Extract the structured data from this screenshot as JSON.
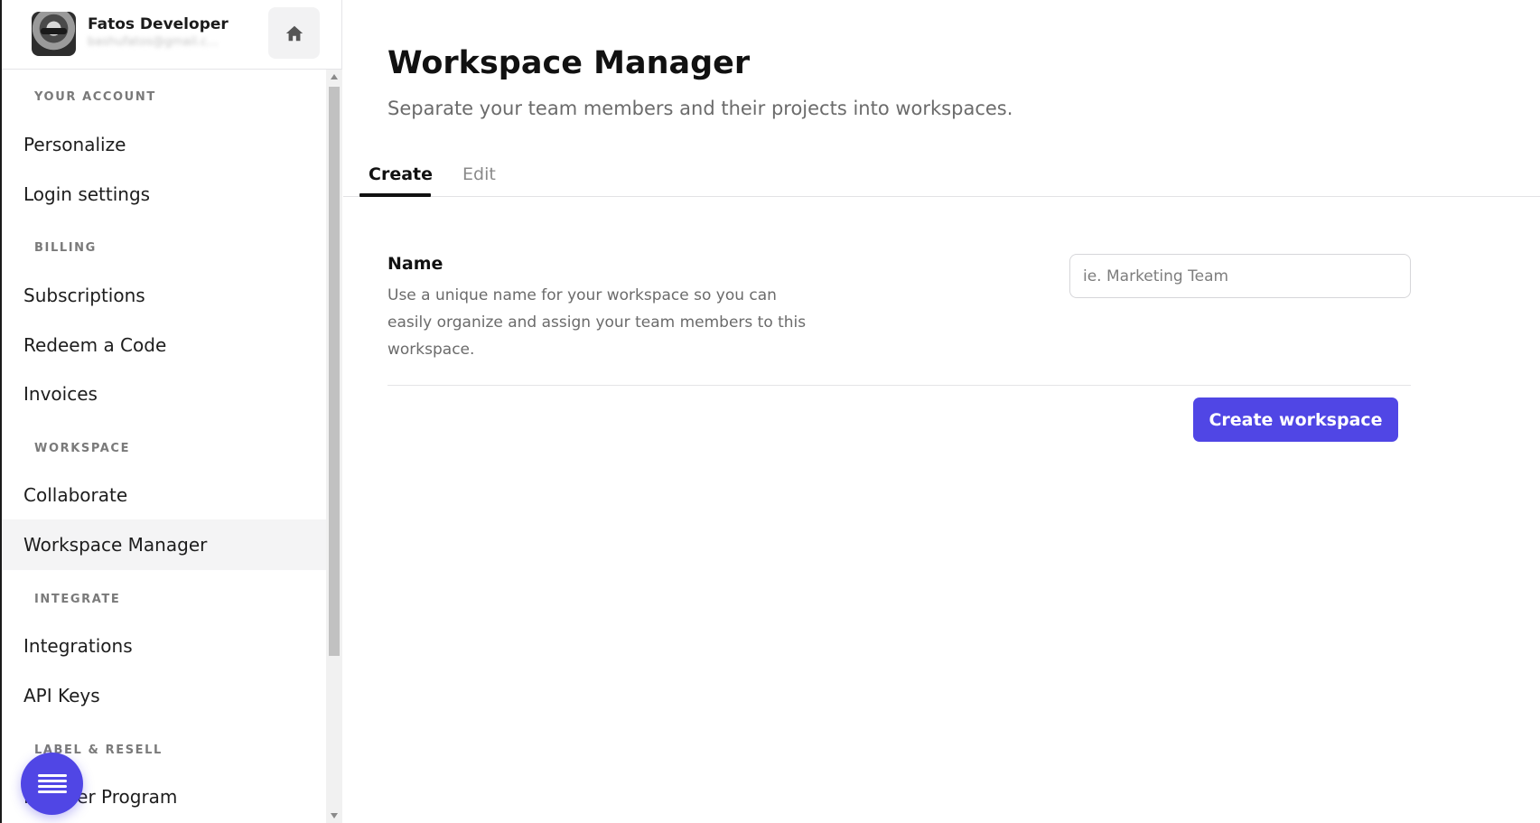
{
  "profile": {
    "name": "Fatos Developer",
    "email": "bashufatos@gmail.c..."
  },
  "sidebar": {
    "sections": [
      {
        "heading": "YOUR ACCOUNT",
        "items": [
          "Personalize",
          "Login settings"
        ]
      },
      {
        "heading": "BILLING",
        "items": [
          "Subscriptions",
          "Redeem a Code",
          "Invoices"
        ]
      },
      {
        "heading": "WORKSPACE",
        "items": [
          "Collaborate",
          "Workspace Manager"
        ]
      },
      {
        "heading": "INTEGRATE",
        "items": [
          "Integrations",
          "API Keys"
        ]
      },
      {
        "heading": "LABEL & RESELL",
        "items": [
          "Reseller Program"
        ]
      }
    ],
    "active_item": "Workspace Manager"
  },
  "main": {
    "title": "Workspace Manager",
    "subtitle": "Separate your team members and their projects into workspaces.",
    "tabs": [
      {
        "label": "Create",
        "active": true
      },
      {
        "label": "Edit",
        "active": false
      }
    ],
    "form": {
      "name_label": "Name",
      "name_help": "Use a unique name for your workspace so you can easily organize and assign your team members to this workspace.",
      "name_placeholder": "ie. Marketing Team",
      "name_value": "",
      "submit_label": "Create workspace"
    }
  },
  "colors": {
    "accent": "#5046e5",
    "active_nav_bg": "#f4f4f5"
  },
  "icons": {
    "home": "home-icon",
    "fab": "menu-icon"
  }
}
